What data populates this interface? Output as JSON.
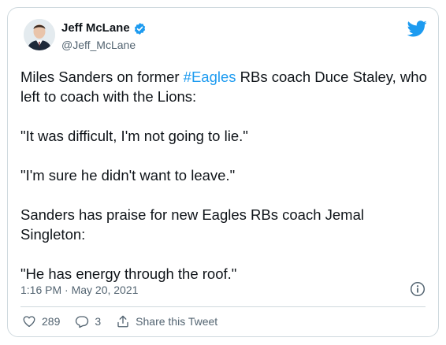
{
  "author": {
    "display_name": "Jeff McLane",
    "handle": "@Jeff_McLane",
    "verified": true
  },
  "tweet": {
    "para1_prefix": "Miles Sanders on former ",
    "hashtag": "#Eagles",
    "para1_suffix": " RBs coach Duce Staley, who left to coach with the Lions:",
    "para2": "\"It was difficult, I'm not going to lie.\"",
    "para3": "\"I'm sure he didn't want to leave.\"",
    "para4": "Sanders has praise for new Eagles RBs coach Jemal Singleton:",
    "para5": "\"He has energy through the roof.\""
  },
  "timestamp": "1:16 PM · May 20, 2021",
  "actions": {
    "likes": "289",
    "replies": "3",
    "share_label": "Share this Tweet"
  },
  "icons": {
    "brand": "twitter-bird-icon",
    "verified": "verified-badge-icon",
    "info": "info-icon",
    "like": "heart-icon",
    "reply": "reply-bubble-icon",
    "share": "share-icon"
  },
  "colors": {
    "brand_blue": "#1d9bf0",
    "text": "#0f1419",
    "secondary": "#536471",
    "border": "#cfd9de"
  }
}
